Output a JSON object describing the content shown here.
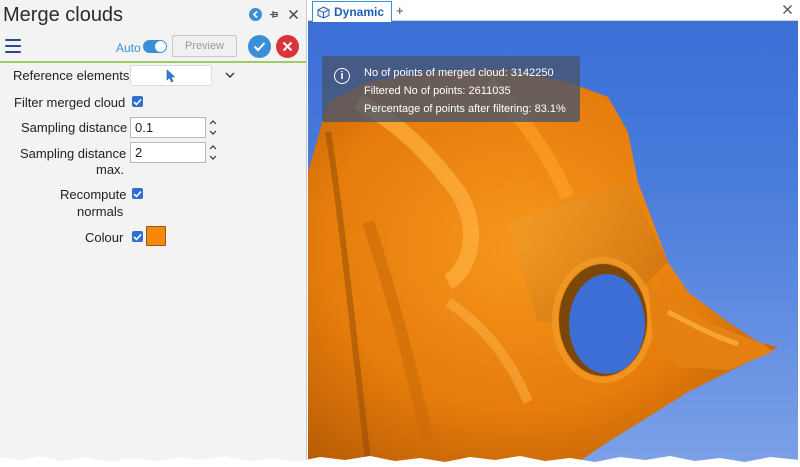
{
  "panel": {
    "title": "Merge clouds",
    "toolbar": {
      "auto_label": "Auto",
      "auto_enabled": true,
      "preview_label": "Preview"
    },
    "fields": {
      "reference_elements_label": "Reference elements",
      "filter_merged_cloud_label": "Filter merged cloud",
      "filter_merged_cloud_checked": true,
      "sampling_distance_label": "Sampling distance",
      "sampling_distance_value": "0.1",
      "sampling_distance_max_label_line1": "Sampling distance",
      "sampling_distance_max_label_line2": "max.",
      "sampling_distance_max_value": "2",
      "recompute_normals_label_line1": "Recompute",
      "recompute_normals_label_line2": "normals",
      "recompute_normals_checked": true,
      "colour_label": "Colour",
      "colour_checked": true,
      "colour_value": "#f5870f"
    }
  },
  "viewport": {
    "tab_label": "Dynamic",
    "add_tab_label": "+",
    "info": {
      "line1": "No of points of merged cloud: 3142250",
      "line2": "Filtered No of points: 2611035",
      "line3": "Percentage of points after filtering: 83.1%"
    },
    "model_color": "#f08a12"
  },
  "colors": {
    "accent": "#3a8fd6",
    "ok": "#3b8ed8",
    "cancel": "#d9343c",
    "divider": "#9ccc65"
  }
}
